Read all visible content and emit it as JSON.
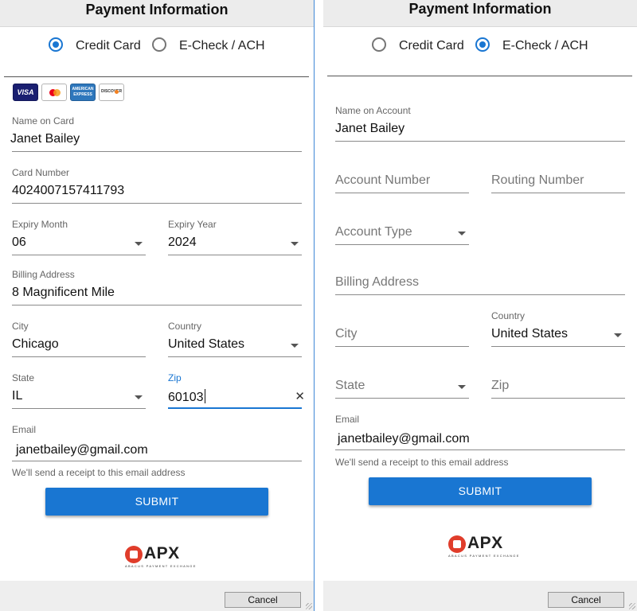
{
  "left": {
    "title": "Payment Information",
    "payment_methods": [
      {
        "label": "Credit Card",
        "selected": true
      },
      {
        "label": "E-Check / ACH",
        "selected": false
      }
    ],
    "card_logos": [
      "VISA",
      "MasterCard",
      "AMERICAN EXPRESS",
      "DISCOVER"
    ],
    "name_on_card": {
      "label": "Name on Card",
      "value": "Janet Bailey"
    },
    "card_number": {
      "label": "Card Number",
      "value": "4024007157411793"
    },
    "expiry_month": {
      "label": "Expiry Month",
      "value": "06"
    },
    "expiry_year": {
      "label": "Expiry Year",
      "value": "2024"
    },
    "billing_address": {
      "label": "Billing Address",
      "value": "8 Magnificent Mile"
    },
    "city": {
      "label": "City",
      "value": "Chicago"
    },
    "country": {
      "label": "Country",
      "value": "United States"
    },
    "state": {
      "label": "State",
      "value": "IL"
    },
    "zip": {
      "label": "Zip",
      "value": "60103",
      "focused": true
    },
    "email": {
      "label": "Email",
      "value": "janetbailey@gmail.com",
      "helper": "We'll send a receipt to this email address"
    },
    "submit_label": "SUBMIT",
    "cancel_label": "Cancel"
  },
  "right": {
    "title": "Payment Information",
    "payment_methods": [
      {
        "label": "Credit Card",
        "selected": false
      },
      {
        "label": "E-Check / ACH",
        "selected": true
      }
    ],
    "name_on_account": {
      "label": "Name on Account",
      "value": "Janet Bailey"
    },
    "account_number": {
      "placeholder": "Account Number"
    },
    "routing_number": {
      "placeholder": "Routing Number"
    },
    "account_type": {
      "placeholder": "Account Type"
    },
    "billing_address": {
      "placeholder": "Billing Address"
    },
    "city": {
      "placeholder": "City"
    },
    "country": {
      "label": "Country",
      "value": "United States"
    },
    "state": {
      "placeholder": "State"
    },
    "zip": {
      "placeholder": "Zip"
    },
    "email": {
      "label": "Email",
      "value": "janetbailey@gmail.com",
      "helper": "We'll send a receipt to this email address"
    },
    "submit_label": "SUBMIT",
    "cancel_label": "Cancel"
  },
  "brand": {
    "logo_text": "APX",
    "logo_subtitle": "ABACUS PAYMENT EXCHANGE",
    "accent_color": "#1976d2",
    "logo_color": "#e03d2b"
  },
  "icons": {
    "dropdown": "caret-down-icon",
    "clear": "clear-x-icon"
  }
}
